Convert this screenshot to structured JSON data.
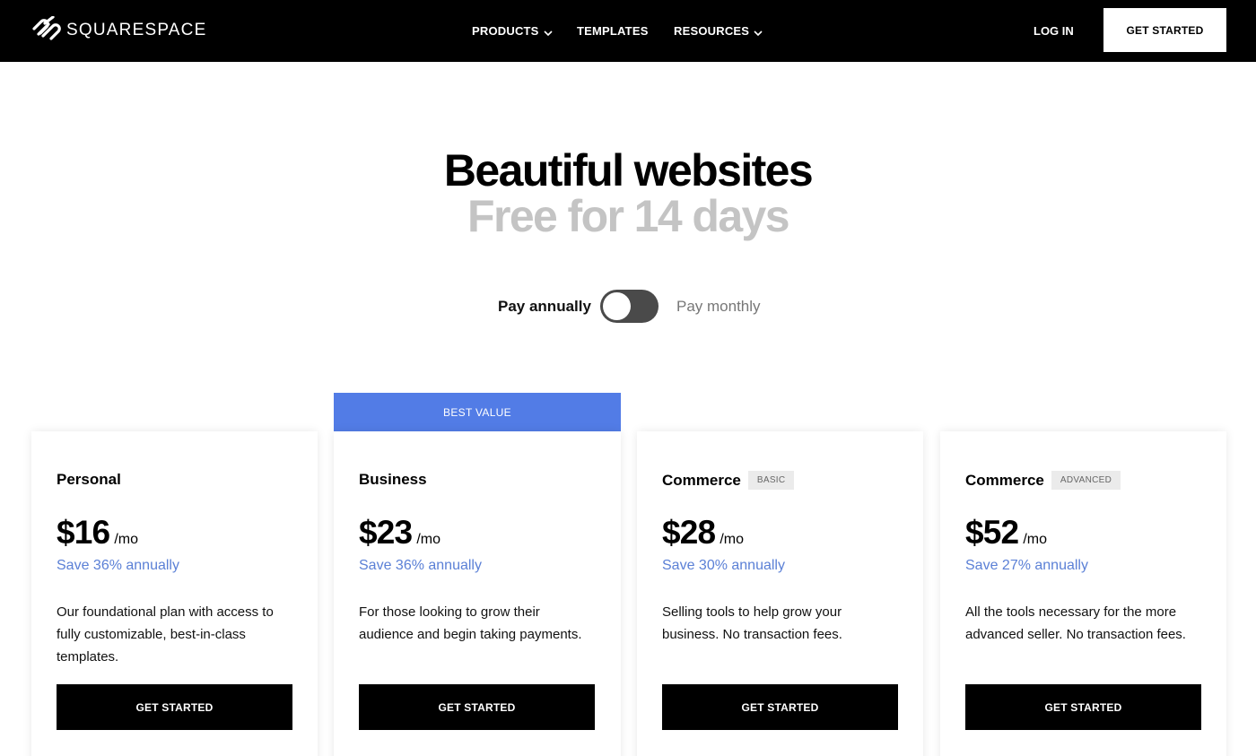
{
  "brand": {
    "name": "SQUARESPACE",
    "icon": "squarespace-logo-icon"
  },
  "nav": {
    "products": "PRODUCTS",
    "templates": "TEMPLATES",
    "resources": "RESOURCES",
    "login": "LOG IN",
    "cta": "GET STARTED"
  },
  "hero": {
    "title": "Beautiful websites",
    "subtitle": "Free for 14 days"
  },
  "billing": {
    "annual_label": "Pay annually",
    "monthly_label": "Pay monthly",
    "selected": "annual"
  },
  "best_value_label": "BEST VALUE",
  "plans": [
    {
      "name": "Personal",
      "badge": "",
      "price": "$16",
      "per": "/mo",
      "save": "Save 36% annually",
      "description": "Our foundational plan with access to fully customizable, best-in-class templates.",
      "cta": "GET STARTED"
    },
    {
      "name": "Business",
      "badge": "",
      "price": "$23",
      "per": "/mo",
      "save": "Save 36% annually",
      "description": "For those looking to grow their audience and begin taking payments.",
      "cta": "GET STARTED"
    },
    {
      "name": "Commerce",
      "badge": "BASIC",
      "price": "$28",
      "per": "/mo",
      "save": "Save 30% annually",
      "description": "Selling tools to help grow your business. No transaction fees.",
      "cta": "GET STARTED"
    },
    {
      "name": "Commerce",
      "badge": "ADVANCED",
      "price": "$52",
      "per": "/mo",
      "save": "Save 27% annually",
      "description": "All the tools necessary for the more advanced seller. No transaction fees.",
      "cta": "GET STARTED"
    }
  ],
  "colors": {
    "header_bg": "#000000",
    "accent_blue": "#527ce6",
    "save_text": "#5b80d6",
    "toggle_bg": "#4a4a4a",
    "subtitle_gray": "#c4c4c4"
  }
}
